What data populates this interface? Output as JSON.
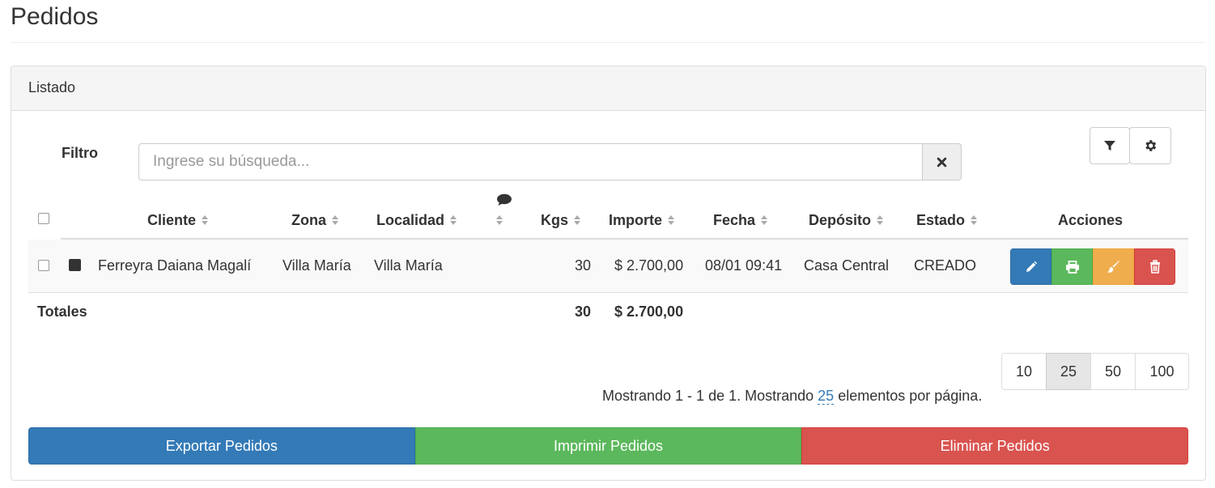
{
  "page": {
    "title": "Pedidos"
  },
  "panel": {
    "heading": "Listado"
  },
  "filter": {
    "label": "Filtro",
    "placeholder": "Ingrese su búsqueda...",
    "value": ""
  },
  "toolbar": {
    "filter_icon": "filter-icon",
    "settings_icon": "gear-icon"
  },
  "table": {
    "columns": {
      "cliente": "Cliente",
      "zona": "Zona",
      "localidad": "Localidad",
      "comments_icon": "comment-icon",
      "kgs": "Kgs",
      "importe": "Importe",
      "fecha": "Fecha",
      "deposito": "Depósito",
      "estado": "Estado",
      "acciones": "Acciones"
    },
    "rows": [
      {
        "cliente": "Ferreyra Daiana Magalí",
        "zona": "Villa María",
        "localidad": "Villa María",
        "kgs": "30",
        "importe": "$ 2.700,00",
        "fecha": "08/01 09:41",
        "deposito": "Casa Central",
        "estado": "CREADO",
        "color": "#333333"
      }
    ],
    "totals": {
      "label": "Totales",
      "kgs": "30",
      "importe": "$ 2.700,00"
    },
    "row_actions": [
      "edit-icon",
      "print-icon",
      "paint-brush-icon",
      "trash-icon"
    ],
    "action_colors": {
      "edit": "#337ab7",
      "print": "#5cb85c",
      "paint": "#f0ad4e",
      "delete": "#d9534f"
    }
  },
  "pagination": {
    "page_sizes": [
      "10",
      "25",
      "50",
      "100"
    ],
    "selected": "25",
    "info_prefix": "Mostrando 1 - 1 de 1. Mostrando",
    "info_count": "25",
    "info_suffix": "elementos por página."
  },
  "bulk_actions": {
    "export": "Exportar Pedidos",
    "print": "Imprimir Pedidos",
    "delete": "Eliminar Pedidos"
  }
}
